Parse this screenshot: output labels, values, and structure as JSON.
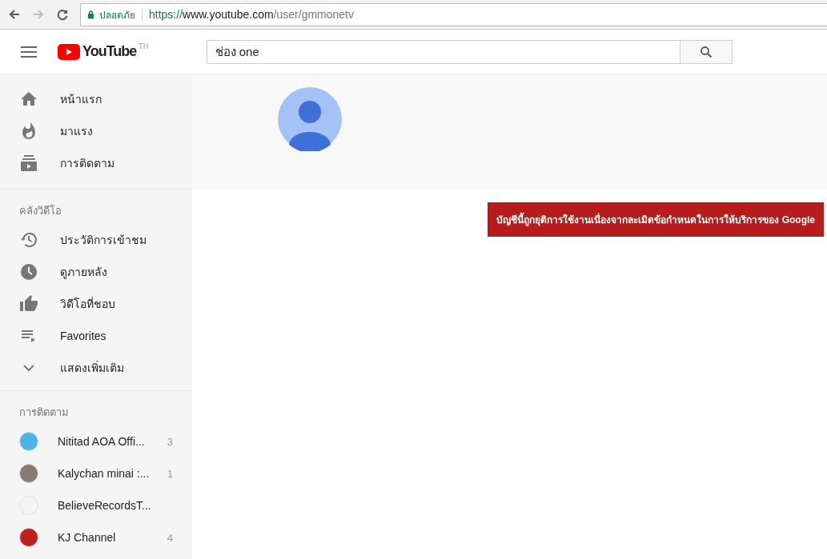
{
  "browser": {
    "security": "ปลอดภัย",
    "url": {
      "scheme": "https://",
      "host": "www.youtube.com",
      "path": "/user/gmmonetv"
    }
  },
  "header": {
    "logo": "YouTube",
    "region": "TH",
    "search": {
      "value": "ช่อง one"
    }
  },
  "sidebar": {
    "main": [
      {
        "label": "หน้าแรก"
      },
      {
        "label": "มาแรง"
      },
      {
        "label": "การติดตาม"
      }
    ],
    "library_title": "คลังวิดีโอ",
    "library": [
      {
        "label": "ประวัติการเข้าชม"
      },
      {
        "label": "ดูภายหลัง"
      },
      {
        "label": "วิดีโอที่ชอบ"
      },
      {
        "label": "Favorites"
      },
      {
        "label": "แสดงเพิ่มเติม"
      }
    ],
    "subscriptions_title": "การติดตาม",
    "subscriptions": [
      {
        "name": "Nititad AOA Offi...",
        "count": "3",
        "color": "#4fb3e8"
      },
      {
        "name": "Kalychan minai :...",
        "count": "1",
        "color": "#8a7a70"
      },
      {
        "name": "BelieveRecordsT...",
        "color": "#f4f4f4"
      },
      {
        "name": "KJ Channel",
        "count": "4",
        "color": "#c0201c"
      }
    ]
  },
  "alert": "บัญชีนี้ถูกยุติการใช้งานเนื่องจากละเมิดข้อกำหนดในการให้บริการของ Google"
}
